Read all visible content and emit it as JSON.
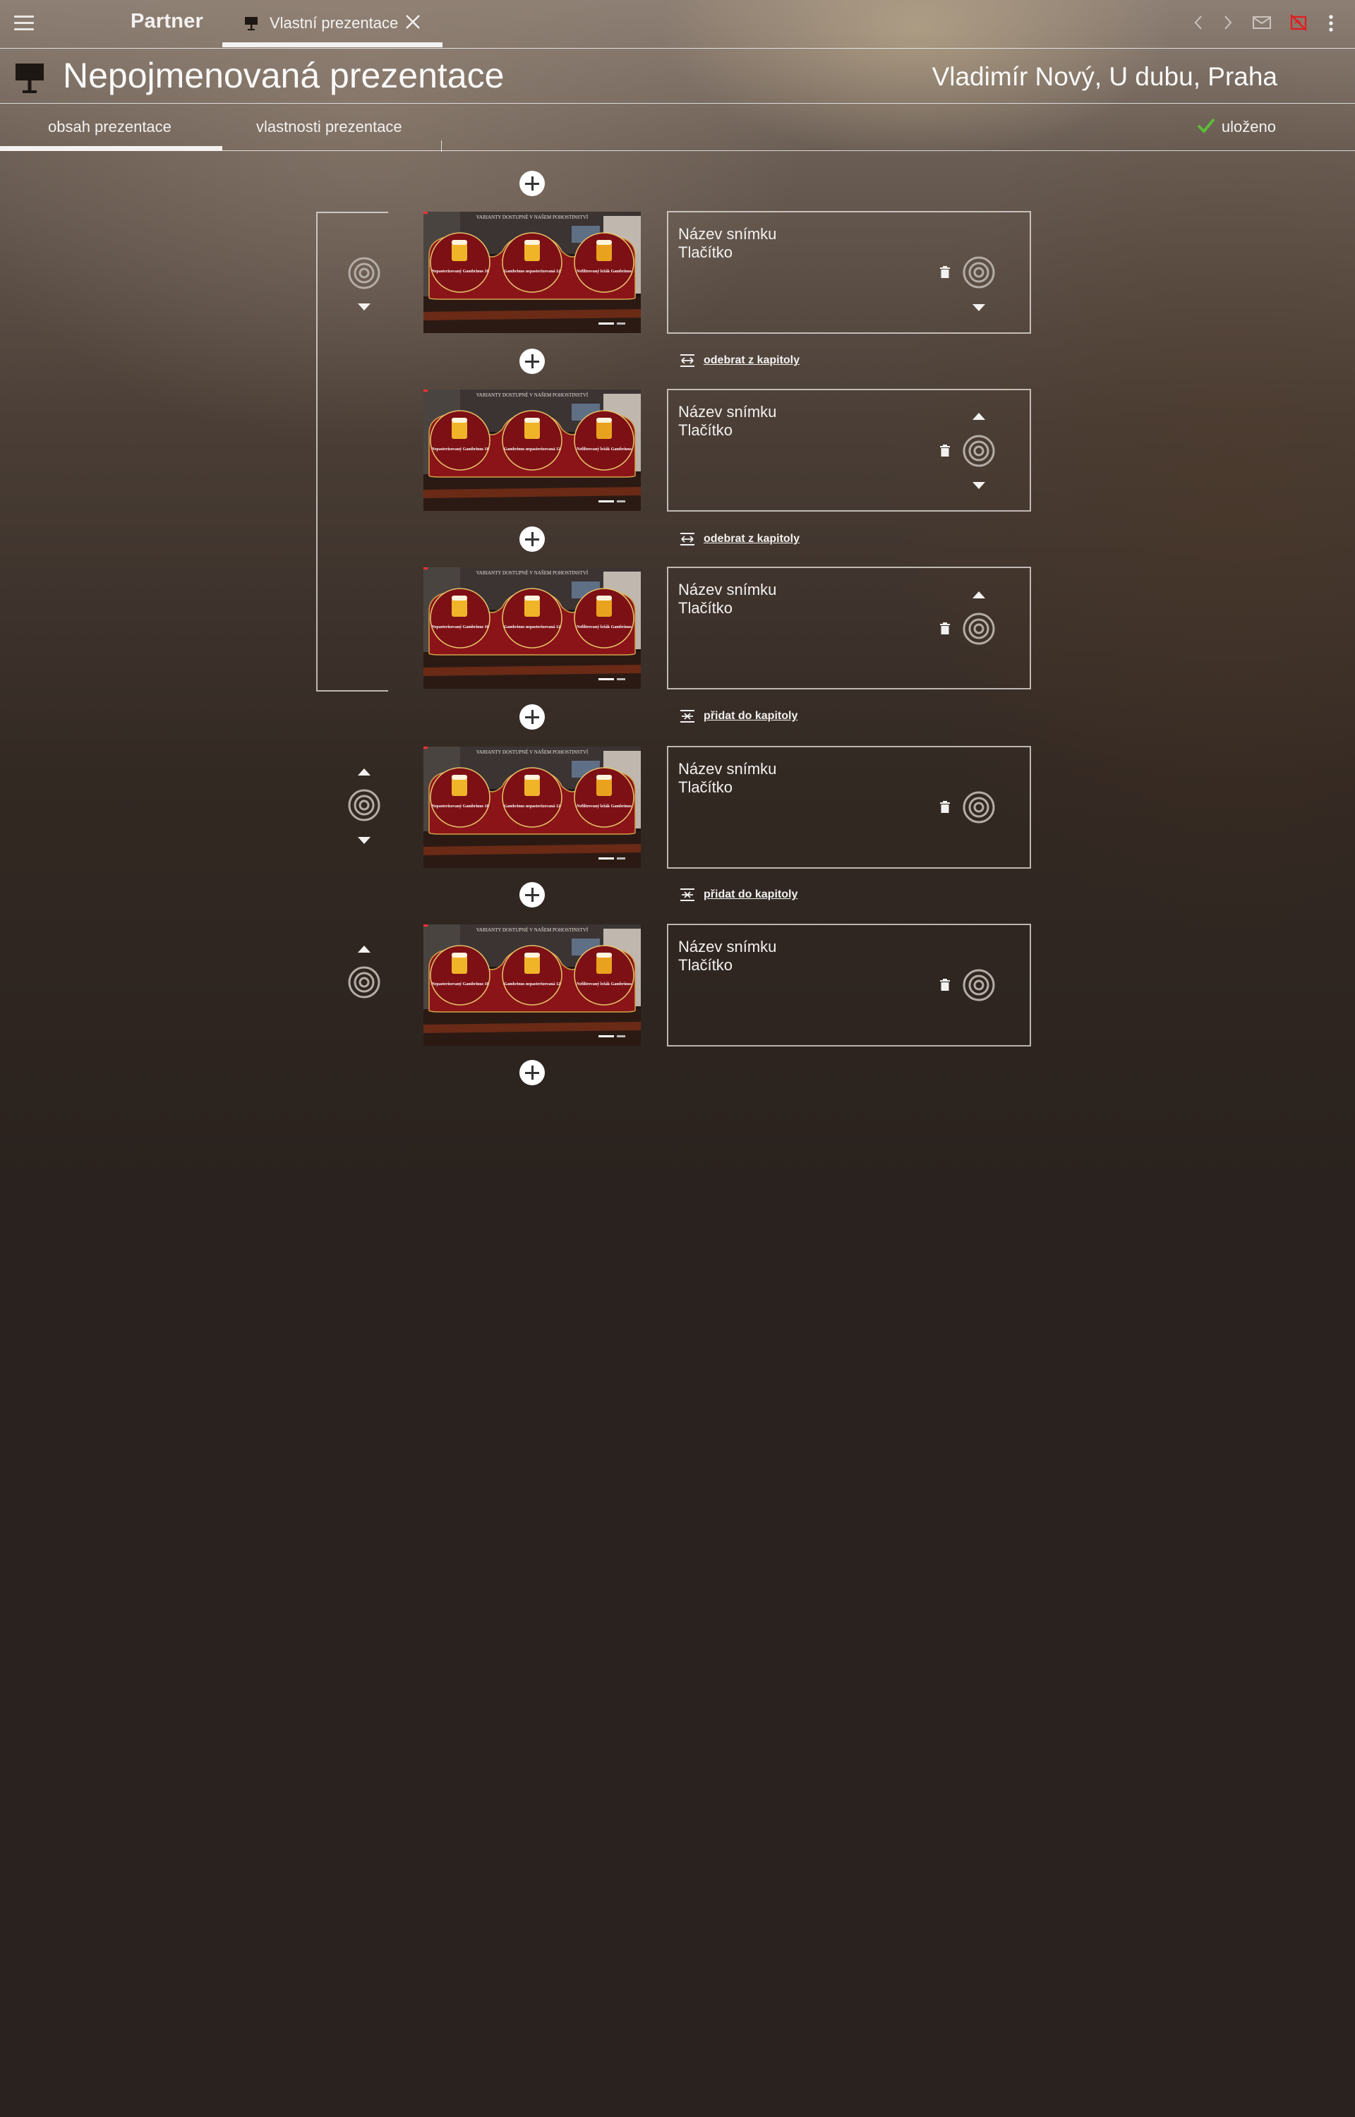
{
  "app": {
    "name": "Partner"
  },
  "open_tab": {
    "label": "Vlastní prezentace"
  },
  "presentation": {
    "title": "Nepojmenovaná prezentace",
    "owner": "Vladimír Nový, U dubu, Praha"
  },
  "subtabs": [
    {
      "label": "obsah prezentace",
      "active": true
    },
    {
      "label": "vlastnosti prezentace",
      "active": false
    }
  ],
  "save_status": "uloženo",
  "colors": {
    "accent_green": "#5dbb3a",
    "alert_red": "#e02020"
  },
  "slides": [
    {
      "name_label": "Název snímku",
      "button_label": "Tlačítko",
      "chapter_action": "odebrat z kapitoly",
      "in_chapter": true
    },
    {
      "name_label": "Název snímku",
      "button_label": "Tlačítko",
      "chapter_action": "odebrat z kapitoly",
      "in_chapter": true
    },
    {
      "name_label": "Název snímku",
      "button_label": "Tlačítko",
      "chapter_action": "přidat do kapitoly",
      "in_chapter": true
    },
    {
      "name_label": "Název snímku",
      "button_label": "Tlačítko",
      "chapter_action": "přidat do kapitoly",
      "in_chapter": false
    },
    {
      "name_label": "Název snímku",
      "button_label": "Tlačítko",
      "chapter_action": "",
      "in_chapter": false
    }
  ],
  "thumbnail": {
    "heading": "VARIANTY DOSTUPNÉ V NAŠEM POHOSTINSTVÍ",
    "items": [
      {
        "title": "Nepasterizovaný Gambrinus 10"
      },
      {
        "title": "Gambrinus nepasterizovaná 12"
      },
      {
        "title": "Nefiltrovaný ležák Gambrinus"
      }
    ]
  }
}
